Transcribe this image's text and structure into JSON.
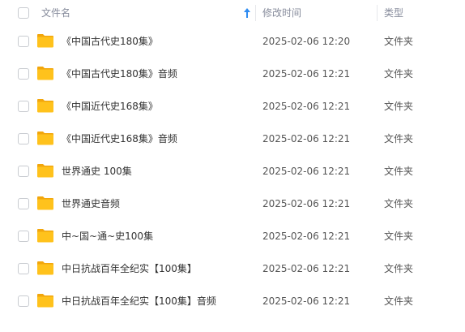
{
  "header": {
    "name": "文件名",
    "time": "修改时间",
    "type": "类型"
  },
  "colors": {
    "folder": "#ffc21c",
    "folder_tab": "#f2a60c",
    "sort_arrow": "#2f8cf2"
  },
  "rows": [
    {
      "name": "《中国古代史180集》",
      "time": "2025-02-06 12:20",
      "type": "文件夹"
    },
    {
      "name": "《中国古代史180集》音频",
      "time": "2025-02-06 12:21",
      "type": "文件夹"
    },
    {
      "name": "《中国近代史168集》",
      "time": "2025-02-06 12:21",
      "type": "文件夹"
    },
    {
      "name": "《中国近代史168集》音频",
      "time": "2025-02-06 12:21",
      "type": "文件夹"
    },
    {
      "name": "世界通史 100集",
      "time": "2025-02-06 12:21",
      "type": "文件夹"
    },
    {
      "name": "世界通史音频",
      "time": "2025-02-06 12:21",
      "type": "文件夹"
    },
    {
      "name": "中~国~通~史100集",
      "time": "2025-02-06 12:21",
      "type": "文件夹"
    },
    {
      "name": "中日抗战百年全纪实【100集】",
      "time": "2025-02-06 12:21",
      "type": "文件夹"
    },
    {
      "name": "中日抗战百年全纪实【100集】音频",
      "time": "2025-02-06 12:21",
      "type": "文件夹"
    }
  ]
}
